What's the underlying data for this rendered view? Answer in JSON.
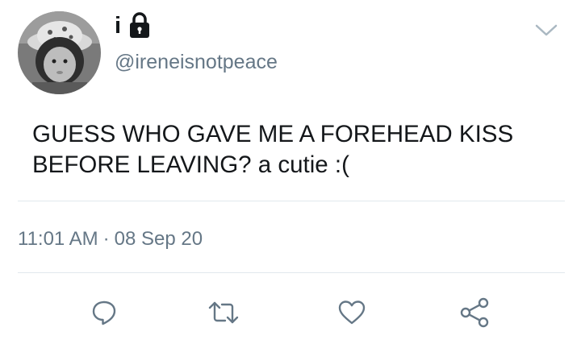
{
  "tweet": {
    "display_name": "i",
    "handle": "@ireneisnotpeace",
    "text_lines": [
      "GUESS WHO GAVE ME A FOREHEAD KISS",
      "BEFORE LEAVING? a cutie :("
    ],
    "time": "11:01 AM",
    "separator": "·",
    "date": "08 Sep 20"
  },
  "icons": {
    "protected": "lock-icon",
    "menu": "chevron-down-icon",
    "reply": "comment-icon",
    "retweet": "retweet-icon",
    "like": "heart-icon",
    "share": "share-icon"
  },
  "colors": {
    "text": "#14171a",
    "secondary_text": "#657786",
    "divider": "#e1e8ed",
    "icon": "#657786",
    "background": "#ffffff"
  }
}
